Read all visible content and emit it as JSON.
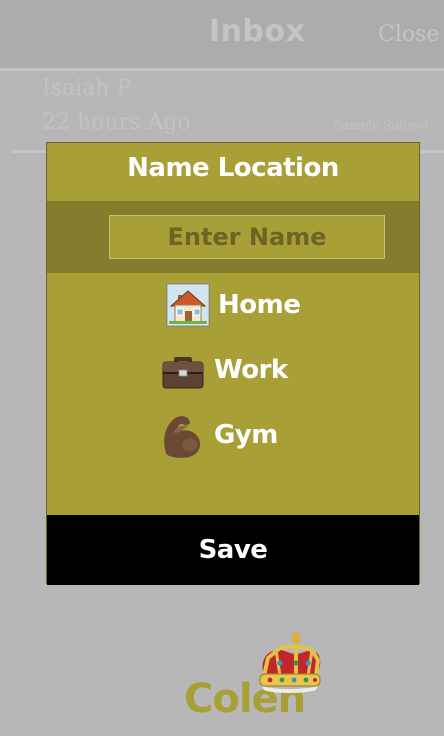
{
  "background": {
    "header": {
      "title": "Inbox",
      "close_label": "Close"
    },
    "message": {
      "sender": "Isaiah P",
      "time": "22 hours Ago",
      "subject": "Sample Subject"
    }
  },
  "modal": {
    "title": "Name Location",
    "name_input": {
      "placeholder": "Enter Name",
      "value": ""
    },
    "options": [
      {
        "label": "Home",
        "icon": "house-icon"
      },
      {
        "label": "Work",
        "icon": "briefcase-icon"
      },
      {
        "label": "Gym",
        "icon": "flexed-biceps-icon"
      }
    ],
    "save_label": "Save"
  },
  "brand": {
    "name": "Colen",
    "icon": "crown-icon"
  },
  "colors": {
    "modal_bg": "#a99f37",
    "input_band": "#857c2e",
    "save_bg": "#000000",
    "overlay": "#b7b7b7"
  }
}
